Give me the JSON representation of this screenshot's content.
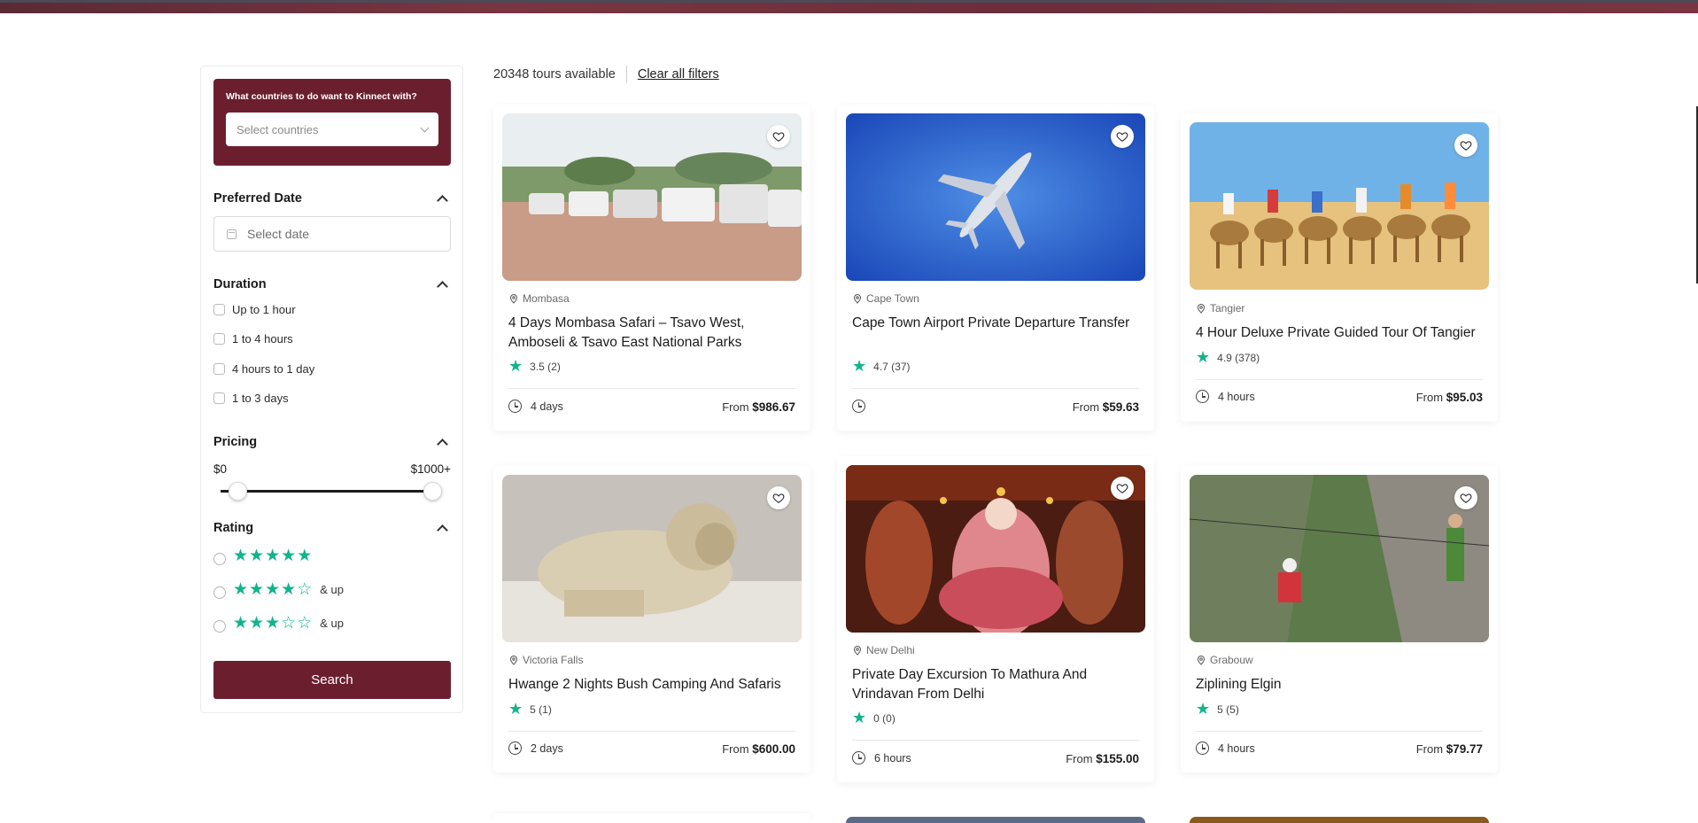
{
  "sidebar": {
    "countries_question": "What countries to do want to Kinnect with?",
    "countries_placeholder": "Select countries",
    "date_title": "Preferred Date",
    "date_placeholder": "Select date",
    "duration_title": "Duration",
    "duration_options": [
      "Up to 1 hour",
      "1 to 4 hours",
      "4 hours to 1 day",
      "1 to 3 days"
    ],
    "pricing_title": "Pricing",
    "price_min": "$0",
    "price_max": "$1000+",
    "rating_title": "Rating",
    "rating_options": [
      {
        "stars": 5,
        "suffix": ""
      },
      {
        "stars": 4,
        "suffix": "& up"
      },
      {
        "stars": 3,
        "suffix": "& up"
      }
    ],
    "search_label": "Search"
  },
  "results": {
    "count_text": "20348 tours available",
    "clear_label": "Clear all filters"
  },
  "cards": [
    {
      "location": "Mombasa",
      "title": "4 Days Mombasa Safari – Tsavo West, Amboseli & Tsavo East National Parks",
      "rating": "3.5 (2)",
      "duration": "4 days",
      "price_prefix": "From",
      "price": "$986.67"
    },
    {
      "location": "Cape Town",
      "title": "Cape Town Airport Private Departure Transfer",
      "rating": "4.7 (37)",
      "duration": "",
      "price_prefix": "From",
      "price": "$59.63"
    },
    {
      "location": "Tangier",
      "title": "4 Hour Deluxe Private Guided Tour Of Tangier",
      "rating": "4.9 (378)",
      "duration": "4 hours",
      "price_prefix": "From",
      "price": "$95.03"
    },
    {
      "location": "Victoria Falls",
      "title": "Hwange 2 Nights Bush Camping And Safaris",
      "rating": "5 (1)",
      "duration": "2 days",
      "price_prefix": "From",
      "price": "$600.00"
    },
    {
      "location": "New Delhi",
      "title": "Private Day Excursion To Mathura And Vrindavan From Delhi",
      "rating": "0 (0)",
      "duration": "6 hours",
      "price_prefix": "From",
      "price": "$155.00"
    },
    {
      "location": "Grabouw",
      "title": "Ziplining Elgin",
      "rating": "5 (5)",
      "duration": "4 hours",
      "price_prefix": "From",
      "price": "$79.77"
    }
  ],
  "colors": {
    "brand": "#6b1f2e",
    "star": "#11b48c"
  }
}
